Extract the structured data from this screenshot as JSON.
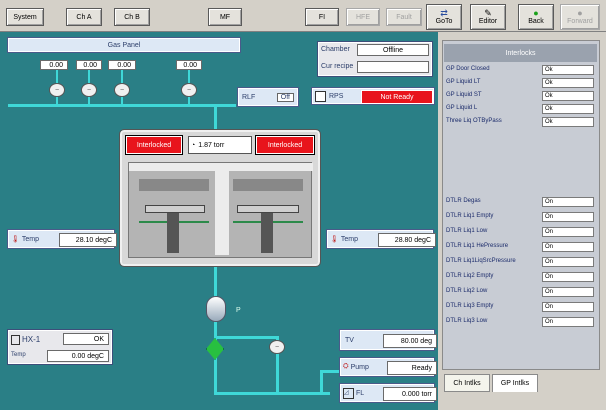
{
  "toolbar": {
    "system": "System",
    "ch_a": "Ch A",
    "ch_b": "Ch B",
    "mf": "MF",
    "fi": "FI",
    "hfe": "HFE",
    "fault": "Fault",
    "goto": "GoTo",
    "editor": "Editor",
    "back": "Back",
    "forward": "Forward"
  },
  "gas_panel": {
    "title": "Gas Panel",
    "readings": [
      "0.00",
      "0.00",
      "0.00",
      "0.00"
    ]
  },
  "rlf": {
    "label": "RLF",
    "value": "Off"
  },
  "chamber": {
    "label": "Chamber",
    "value": "Offline",
    "cur_recipe_label": "Cur recipe",
    "cur_recipe_value": ""
  },
  "rps": {
    "label": "RPS",
    "value": "Not Ready"
  },
  "chamber_view": {
    "interlock_left": "Interlocked",
    "interlock_right": "Interlocked",
    "pressure": "1.87 torr"
  },
  "temp_left": {
    "label": "Temp",
    "value": "28.10 degC"
  },
  "temp_right": {
    "label": "Temp",
    "value": "28.80 degC"
  },
  "vacuum_label": "P",
  "hx": {
    "label": "HX-1",
    "status": "OK",
    "temp_label": "Temp",
    "temp_value": "0.00 degC"
  },
  "tv": {
    "label": "TV",
    "value": "80.00 deg"
  },
  "pump": {
    "label": "Pump",
    "value": "Ready"
  },
  "fl": {
    "label": "FL",
    "value": "0.000 torr"
  },
  "interlocks": {
    "title": "Interlocks",
    "top_items": [
      {
        "label": "GP Door Closed",
        "value": "Ok"
      },
      {
        "label": "GP Liquid LT",
        "value": "Ok"
      },
      {
        "label": "GP Liquid ST",
        "value": "Ok"
      },
      {
        "label": "GP Liquid L",
        "value": "Ok"
      },
      {
        "label": "Three Liq OTByPass",
        "value": "Ok"
      }
    ],
    "bottom_items": [
      {
        "label": "DTLR Degas",
        "value": "On"
      },
      {
        "label": "DTLR Liq1 Empty",
        "value": "On"
      },
      {
        "label": "DTLR Liq1 Low",
        "value": "On"
      },
      {
        "label": "DTLR Liq1 HePressure",
        "value": "On"
      },
      {
        "label": "DTLR Liq1LiqSrcPressure",
        "value": "On"
      },
      {
        "label": "DTLR Liq2 Empty",
        "value": "On"
      },
      {
        "label": "DTLR Liq2 Low",
        "value": "On"
      },
      {
        "label": "DTLR Liq3 Empty",
        "value": "On"
      },
      {
        "label": "DTLR Liq3 Low",
        "value": "On"
      }
    ],
    "tabs": [
      "Ch Intlks",
      "GP Intlks"
    ]
  },
  "colors": {
    "panel_bg": "#2a7f86",
    "pipe": "#3fd8d8",
    "alarm": "#e8141c"
  },
  "icons": [
    "goto-icon",
    "editor-icon",
    "back-icon",
    "forward-icon",
    "thermometer-icon",
    "gauge-icon",
    "valve-icon"
  ]
}
